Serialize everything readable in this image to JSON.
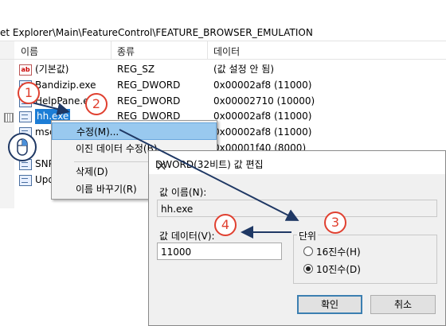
{
  "registry": {
    "path": "et Explorer\\Main\\FeatureControl\\FEATURE_BROWSER_EMULATION",
    "columns": {
      "name": "이름",
      "type": "종류",
      "data": "데이터"
    },
    "rows": [
      {
        "icon": "string-value-icon",
        "badge": "ab",
        "name": "(기본값)",
        "type": "REG_SZ",
        "data": "(값 설정 안 됨)"
      },
      {
        "icon": "dword-value-icon",
        "name": "Bandizip.exe",
        "type": "REG_DWORD",
        "data": "0x00002af8 (11000)"
      },
      {
        "icon": "dword-value-icon",
        "name": "HelpPane.e",
        "type": "REG_DWORD",
        "data": "0x00002710 (10000)"
      },
      {
        "icon": "dword-value-icon",
        "name": "hh.exe",
        "type": "REG_DWORD",
        "data": "0x00002af8 (11000)",
        "selected": true
      },
      {
        "icon": "dword-value-icon",
        "name": "msc",
        "type": "",
        "data": "0x00002af8 (11000)"
      },
      {
        "icon": "dword-value-icon",
        "name": "",
        "type": "",
        "data": "0x00001f40 (8000)"
      },
      {
        "icon": "dword-value-icon",
        "name": "SNP",
        "type": "",
        "data": ""
      },
      {
        "icon": "dword-value-icon",
        "name": "Upd",
        "type": "",
        "data": ""
      }
    ]
  },
  "context_menu": {
    "items": [
      {
        "label": "수정(M)...",
        "highlighted": true
      },
      {
        "label": "이진 데이터 수정(B)..."
      },
      {
        "label": "삭제(D)"
      },
      {
        "label": "이름 바꾸기(R)"
      }
    ]
  },
  "dialog": {
    "title": "DWORD(32비트) 값 편집",
    "close_glyph": "×",
    "value_name_label": "값 이름(N):",
    "value_name": "hh.exe",
    "value_data_label": "값 데이터(V):",
    "value_data": "11000",
    "base_label": "단위",
    "base_options": [
      {
        "label": "16진수(H)",
        "checked": false
      },
      {
        "label": "10진수(D)",
        "checked": true
      }
    ],
    "ok_label": "확인",
    "cancel_label": "취소"
  },
  "callouts": [
    "1",
    "2",
    "3",
    "4"
  ],
  "colors": {
    "callout": "#e04030",
    "arrow": "#1f3864",
    "selection": "#1c7dd6",
    "menu_highlight": "#99c9ef"
  }
}
